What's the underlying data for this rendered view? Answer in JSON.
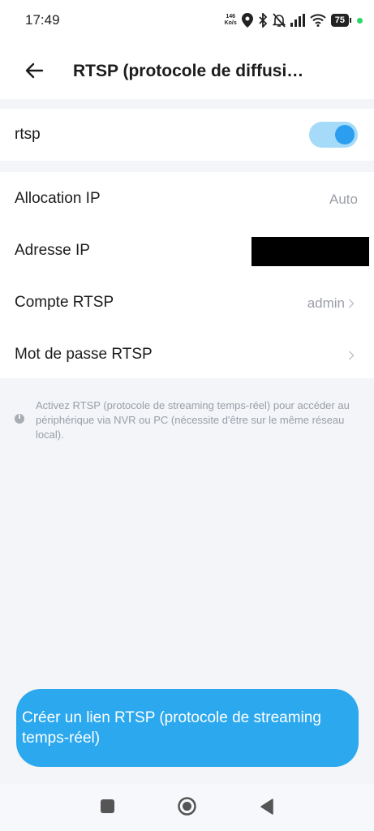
{
  "status_bar": {
    "time": "17:49",
    "net_speed_value": "146",
    "net_speed_unit": "Ko/s",
    "battery": "75",
    "icons": [
      "location-icon",
      "bluetooth-icon",
      "mute-icon",
      "signal-icon",
      "wifi-icon",
      "battery-icon"
    ],
    "active_dot_color": "#2bd66a"
  },
  "header": {
    "title": "RTSP (protocole de diffusi…",
    "back_icon": "back-arrow-icon"
  },
  "toggle_row": {
    "label": "rtsp",
    "enabled": true,
    "accent_color": "#2b9ef0"
  },
  "settings": {
    "ip_allocation": {
      "label": "Allocation IP",
      "value": "Auto"
    },
    "ip_address": {
      "label": "Adresse IP",
      "value_redacted": true
    },
    "rtsp_account": {
      "label": "Compte RTSP",
      "value": "admin"
    },
    "rtsp_password": {
      "label": "Mot de passe RTSP"
    }
  },
  "info": {
    "icon": "info-icon",
    "text": "Activez RTSP (protocole de streaming temps-réel) pour accéder au périphérique via NVR ou PC (nécessite d'être sur le même réseau local)."
  },
  "cta": {
    "label": "Créer un lien RTSP (protocole de streaming temps-réel)",
    "color": "#2ba8ee"
  },
  "nav": {
    "icons": [
      "recents-icon",
      "home-icon",
      "back-triangle-icon"
    ]
  }
}
